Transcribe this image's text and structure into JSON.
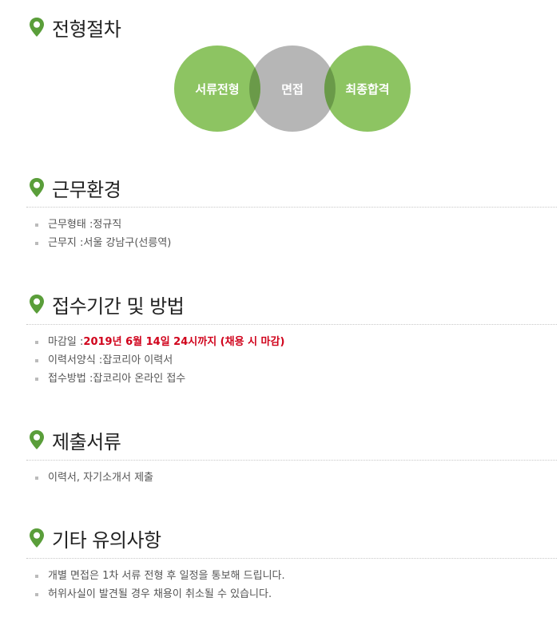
{
  "sections": [
    {
      "title": "전형절차"
    },
    {
      "title": "근무환경"
    },
    {
      "title": "접수기간 및 방법"
    },
    {
      "title": "제출서류"
    },
    {
      "title": "기타 유의사항"
    }
  ],
  "process": {
    "steps": [
      "서류전형",
      "면접",
      "최종합격"
    ],
    "colors": {
      "green": "#8dc462",
      "gray": "#b6b6b6",
      "overlap": "#6a9a49"
    }
  },
  "work_env": [
    {
      "label": "근무형태 : ",
      "value": "정규직"
    },
    {
      "label": "근무지 : ",
      "value": "서울 강남구(선릉역)"
    }
  ],
  "application": [
    {
      "label": "마감일 : ",
      "value": "2019년 6월 14일 24시까지 (채용 시 마감)"
    },
    {
      "label": "이력서양식 : ",
      "value": "잡코리아 이력서"
    },
    {
      "label": "접수방법 : ",
      "value": "잡코리아 온라인 접수"
    }
  ],
  "documents": [
    {
      "text": "이력서, 자기소개서 제출"
    }
  ],
  "notes": [
    {
      "text": "개별 면접은 1차 서류 전형 후 일정을 통보해 드립니다."
    },
    {
      "text": "허위사실이 발견될 경우 채용이 취소될 수 있습니다."
    }
  ],
  "accent_color": "#5a9e3a",
  "deadline_color": "#d0021b"
}
